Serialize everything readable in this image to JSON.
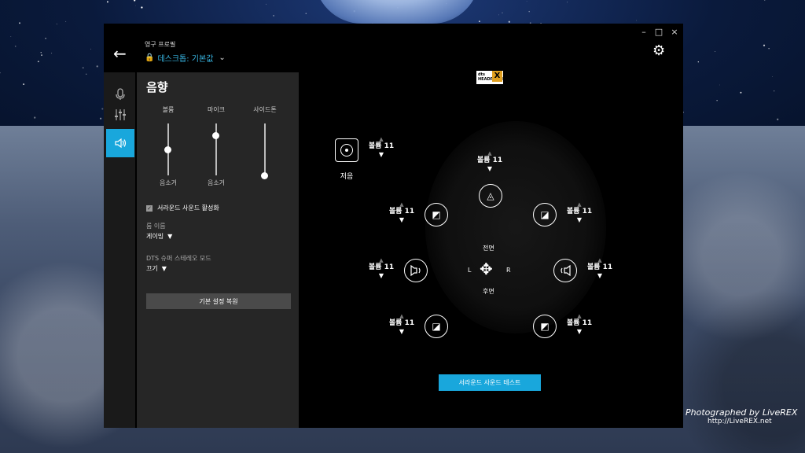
{
  "titlebar": {
    "minimize": "–",
    "maximize": "□",
    "close": "×"
  },
  "header": {
    "back_icon": "arrow-left-icon",
    "profile_caption": "영구 프로필",
    "profile_name": "데스크톱: 기본값",
    "settings_icon": "gear-icon"
  },
  "rail": [
    {
      "icon": "microphone-icon",
      "active": false
    },
    {
      "icon": "equalizer-icon",
      "active": false
    },
    {
      "icon": "speaker-icon",
      "active": true
    }
  ],
  "panel": {
    "title": "음향",
    "sliders": [
      {
        "label": "볼륨",
        "value": 0.5,
        "mute_label": "음소거"
      },
      {
        "label": "마이크",
        "value": 0.78,
        "mute_label": "음소거"
      },
      {
        "label": "사이드톤",
        "value": 0.0,
        "mute_label": ""
      }
    ],
    "surround_enable": {
      "label": "서라운드 사운드 활성화",
      "checked": true
    },
    "room_name": {
      "label": "룸 이름",
      "value": "게이밍"
    },
    "dts_mode": {
      "label": "DTS 슈퍼 스테레오 모드",
      "value": "끄기"
    },
    "reset_button": "기본 설정 복원"
  },
  "surround": {
    "subwoofer": {
      "label": "저음",
      "volume": "볼륨 11"
    },
    "center": {
      "volume": "볼륨 11"
    },
    "front_left": {
      "volume": "볼륨 11"
    },
    "front_right": {
      "volume": "볼륨 11"
    },
    "side_left": {
      "volume": "볼륨 11"
    },
    "side_right": {
      "volume": "볼륨 11"
    },
    "rear_left": {
      "volume": "볼륨 11"
    },
    "rear_right": {
      "volume": "볼륨 11"
    },
    "front_label": "전면",
    "rear_label": "후면",
    "left_label": "L",
    "right_label": "R",
    "test_button": "서라운드 사운드 테스트"
  },
  "dts_logo": {
    "text": "dts HEADPHONE",
    "mark": "X"
  },
  "watermark": {
    "line1": "Photographed by LiveREX",
    "line2": "http://LiveREX.net"
  }
}
